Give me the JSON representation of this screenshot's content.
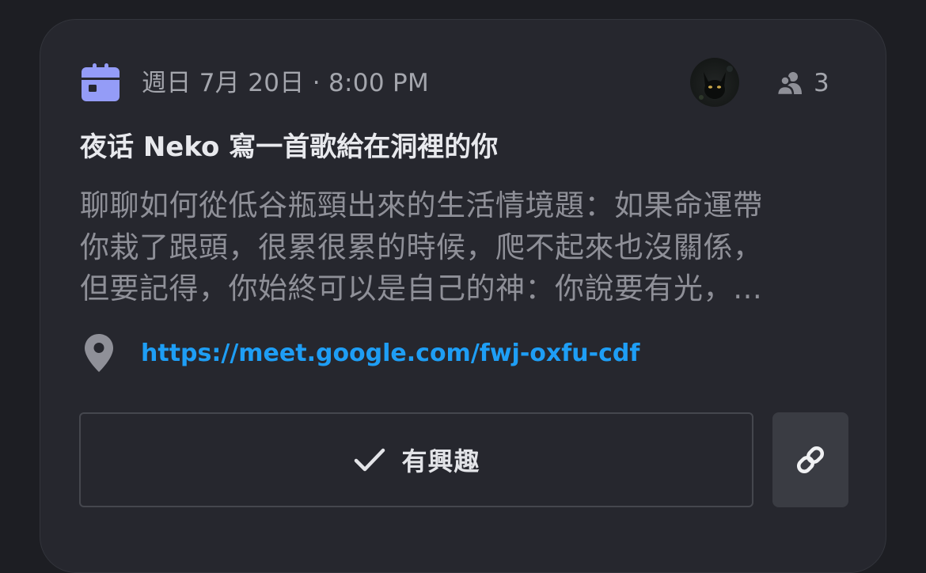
{
  "event": {
    "date_time": "週日 7月 20日 · 8:00 PM",
    "interested_count": "3",
    "title": "夜话 Neko 寫一首歌給在洞裡的你",
    "description_lines": [
      "聊聊如何從低谷瓶頸出來的生活情境題：如果命運帶",
      "你栽了跟頭，很累很累的時候，爬不起來也沒關係，",
      "但要記得，你始終可以是自己的神：你說要有光，…"
    ],
    "location_url": "https://meet.google.com/fwj-oxfu-cdf",
    "interested_label": "有興趣"
  },
  "icons": {
    "calendar": "calendar-icon",
    "people": "people-icon",
    "location": "location-pin-icon",
    "check": "check-icon",
    "link": "link-icon"
  },
  "colors": {
    "calendar_accent": "#949cf7",
    "link": "#1e9ef5",
    "card_bg": "#26272e",
    "page_bg": "#1d1e23"
  }
}
